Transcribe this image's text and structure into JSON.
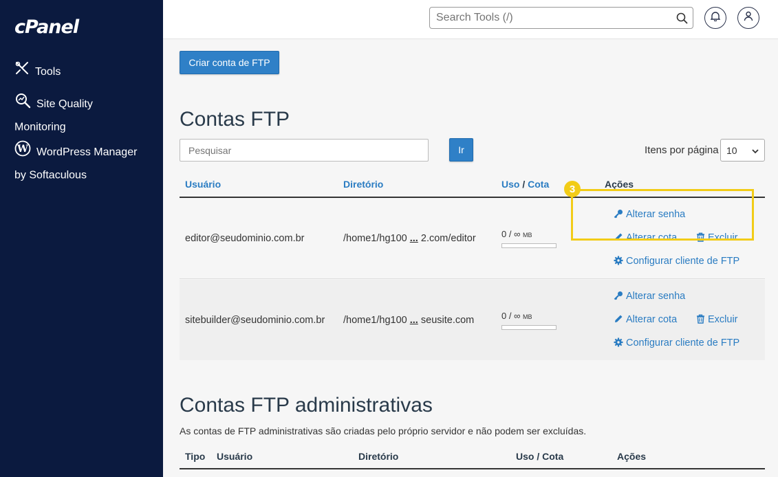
{
  "sidebar": {
    "logo": "cPanel",
    "items": [
      {
        "label": "Tools",
        "icon": "tools-icon"
      },
      {
        "label_line1": "Site Quality",
        "label_line2": "Monitoring",
        "icon": "magnifier-chart-icon"
      },
      {
        "label_line1": "WordPress Manager",
        "label_line2": "by Softaculous",
        "icon": "wordpress-icon"
      }
    ]
  },
  "header": {
    "search_placeholder": "Search Tools (/)"
  },
  "main": {
    "create_button": "Criar conta de FTP",
    "section1_title": "Contas FTP",
    "filter_placeholder": "Pesquisar",
    "go_button": "Ir",
    "per_page_label": "Itens por página",
    "per_page_value": "10",
    "columns": {
      "user": "Usuário",
      "dir": "Diretório",
      "usage": "Uso",
      "sep": "/",
      "quota": "Cota",
      "actions": "Ações"
    },
    "rows": [
      {
        "user": "editor@seudominio.com.br",
        "dir_start": "/home1/hg100",
        "dir_ellipsis": "...",
        "dir_end": "2.com/editor",
        "usage": "0 / ∞",
        "unit": "MB"
      },
      {
        "user": "sitebuilder@seudominio.com.br",
        "dir_start": "/home1/hg100",
        "dir_ellipsis": "...",
        "dir_end": "seusite.com",
        "usage": "0 / ∞",
        "unit": "MB"
      }
    ],
    "actions": {
      "change_password": "Alterar senha",
      "change_quota": "Alterar cota",
      "delete": "Excluir",
      "configure_client": "Configurar cliente de FTP"
    },
    "step_badge": "3",
    "section2_title": "Contas FTP administrativas",
    "section2_desc": "As contas de FTP administrativas são criadas pelo próprio servidor e não podem ser excluídas.",
    "admin_columns": {
      "type": "Tipo",
      "user": "Usuário",
      "dir": "Diretório",
      "usage_quota": "Uso / Cota",
      "actions": "Ações"
    }
  },
  "colors": {
    "sidebar_bg": "#0b1a3f",
    "primary": "#2f80c7",
    "link": "#2a7cc2",
    "highlight": "#f2cc17"
  }
}
